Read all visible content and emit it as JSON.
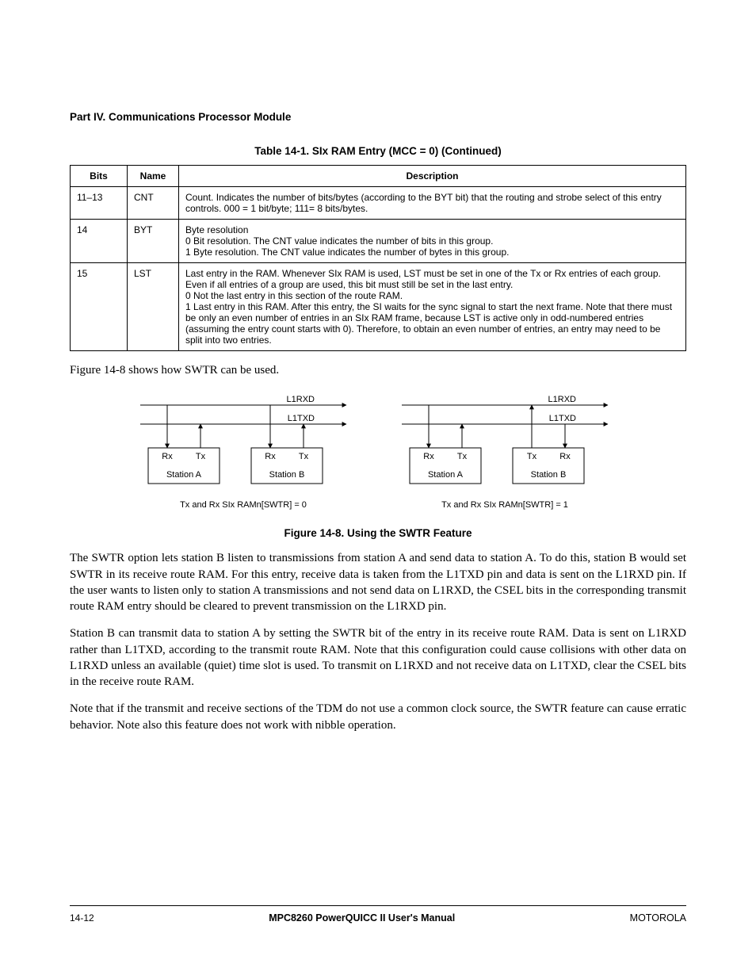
{
  "header": {
    "part": "Part IV.  Communications Processor Module"
  },
  "table": {
    "caption": "Table 14-1. SIx RAM Entry (MCC = 0) (Continued)",
    "cols": {
      "bits": "Bits",
      "name": "Name",
      "desc": "Description"
    },
    "rows": [
      {
        "bits": "11–13",
        "name": "CNT",
        "desc": "Count. Indicates the number of bits/bytes (according to the BYT bit) that the routing and strobe select of this entry controls. 000 = 1 bit/byte; 111= 8 bits/bytes."
      },
      {
        "bits": "14",
        "name": "BYT",
        "desc": "Byte resolution\n0 Bit resolution. The CNT value indicates the number of bits in this group.\n1 Byte resolution. The CNT value indicates the number of bytes in this group."
      },
      {
        "bits": "15",
        "name": "LST",
        "desc": "Last entry in the RAM. Whenever SIx RAM is used, LST must be set in one of the Tx or Rx entries of each group. Even if all entries of a group are used, this bit must still be set in the last entry.\n0 Not the last entry in this section of the route RAM.\n1 Last entry in this RAM. After this entry, the SI waits for the sync signal to start the next frame. Note that there must be only an even number of entries in an SIx RAM frame, because LST is active only in odd-numbered entries (assuming the entry count starts with 0). Therefore, to obtain an even number of entries, an entry may need to be split into two entries."
      }
    ]
  },
  "intro_figure": "Figure 14-8 shows how SWTR can be used.",
  "diagram": {
    "l1rxd": "L1RXD",
    "l1txd": "L1TXD",
    "rx": "Rx",
    "tx": "Tx",
    "stationA": "Station A",
    "stationB": "Station B",
    "left_caption": "Tx and Rx SIx RAMn[SWTR] = 0",
    "right_caption": "Tx and Rx SIx RAMn[SWTR] = 1"
  },
  "figure_caption": "Figure 14-8. Using the SWTR Feature",
  "paragraphs": {
    "p1": "The SWTR option lets station B listen to transmissions from station A and send data to station A. To do this, station B would set SWTR in its receive route RAM. For this entry, receive data is taken from the L1TXD pin and data is sent on the L1RXD pin. If the user wants to listen only to station A transmissions and not send data on L1RXD, the CSEL bits in the corresponding transmit route RAM entry should be cleared to prevent transmission on the L1RXD pin.",
    "p2": "Station B can transmit data to station A by setting the SWTR bit of the entry in its receive route RAM. Data is sent on L1RXD rather than L1TXD, according to the transmit route RAM. Note that this configuration could cause collisions with other data on L1RXD unless an available (quiet) time slot is used. To transmit on L1RXD and not receive data on L1TXD, clear the CSEL bits in the receive route RAM.",
    "p3": "Note that if the transmit and receive sections of the TDM do not use a common clock source, the SWTR feature can cause erratic behavior. Note also this feature does not work with nibble operation."
  },
  "footer": {
    "page": "14-12",
    "manual": "MPC8260 PowerQUICC II User's Manual",
    "brand": "MOTOROLA"
  }
}
